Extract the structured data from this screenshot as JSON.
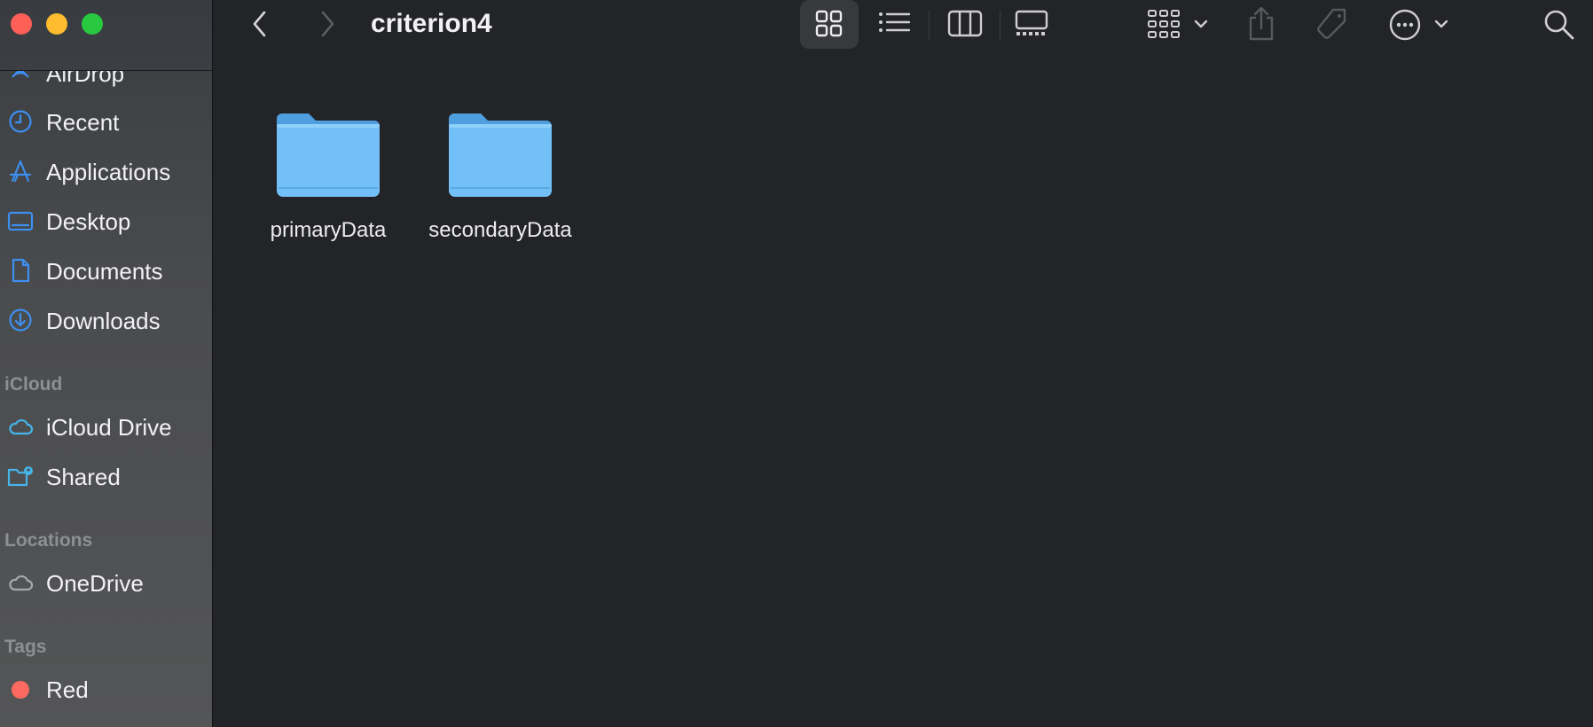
{
  "window": {
    "title": "criterion4"
  },
  "sidebar": {
    "favorites": [
      {
        "label": "AirDrop",
        "icon": "airdrop-icon"
      },
      {
        "label": "Recent",
        "icon": "clock-icon"
      },
      {
        "label": "Applications",
        "icon": "applications-icon"
      },
      {
        "label": "Desktop",
        "icon": "desktop-icon"
      },
      {
        "label": "Documents",
        "icon": "document-icon"
      },
      {
        "label": "Downloads",
        "icon": "download-icon"
      }
    ],
    "icloud_header": "iCloud",
    "icloud": [
      {
        "label": "iCloud Drive",
        "icon": "cloud-icon"
      },
      {
        "label": "Shared",
        "icon": "shared-folder-icon"
      }
    ],
    "locations_header": "Locations",
    "locations": [
      {
        "label": "OneDrive",
        "icon": "cloud-icon"
      }
    ],
    "tags_header": "Tags",
    "tags": [
      {
        "label": "Red",
        "color": "#fe6a5f"
      }
    ]
  },
  "toolbar": {
    "active_view": "icon-view",
    "buttons": [
      "back-icon",
      "forward-icon",
      "icon-view-icon",
      "list-view-icon",
      "column-view-icon",
      "gallery-view-icon",
      "group-icon",
      "share-icon",
      "tag-icon",
      "more-icon",
      "search-icon"
    ]
  },
  "files": [
    {
      "name": "primaryData",
      "kind": "folder"
    },
    {
      "name": "secondaryData",
      "kind": "folder"
    }
  ],
  "colors": {
    "accent": "#3d8ff0",
    "folder": "#6dbef5",
    "window_bg": "#232427"
  }
}
